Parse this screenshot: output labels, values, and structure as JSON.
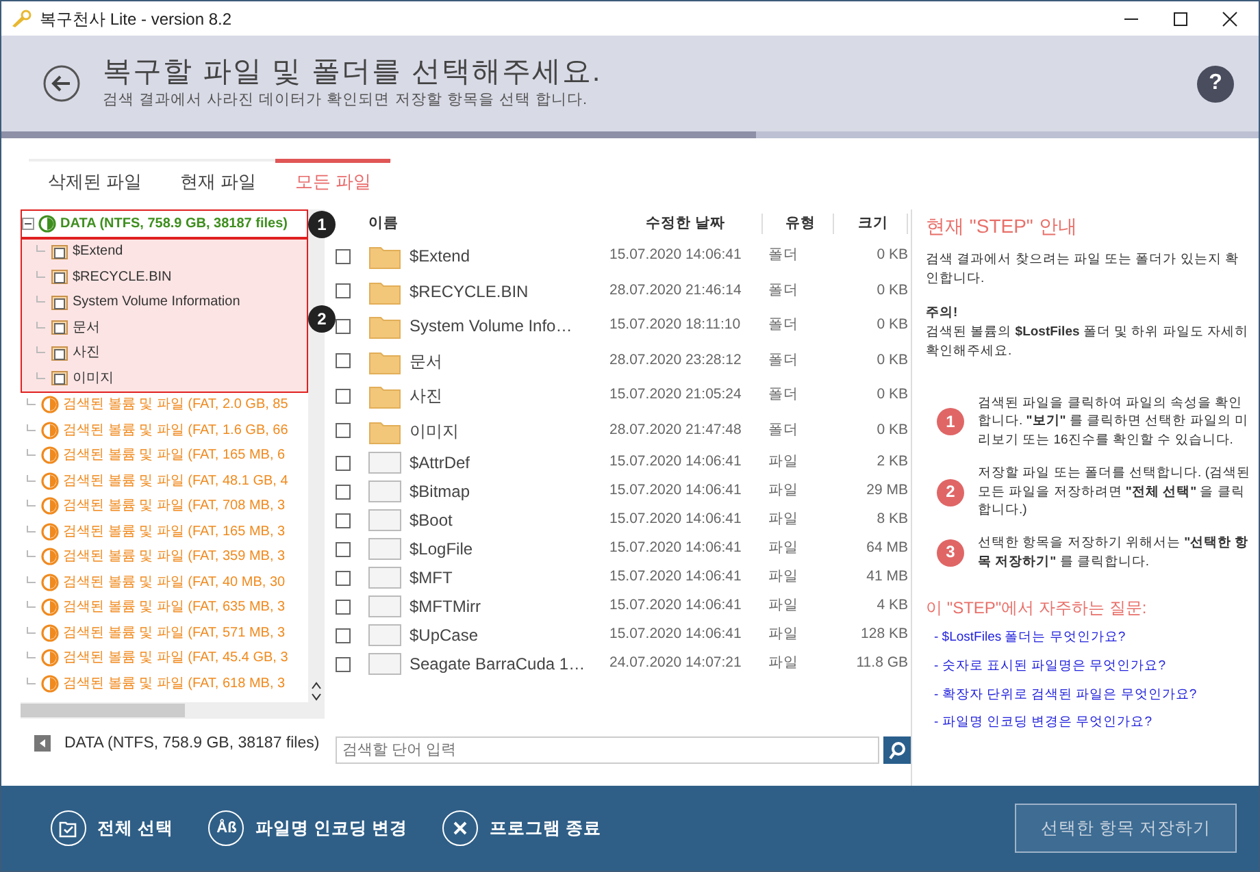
{
  "window": {
    "title": "복구천사 Lite - version 8.2"
  },
  "header": {
    "title": "복구할 파일 및 폴더를 선택해주세요.",
    "subtitle": "검색 결과에서 사라진 데이터가 확인되면 저장할 항목을 선택 합니다.",
    "help_glyph": "?"
  },
  "progress": {
    "level": 0.6
  },
  "tabs": [
    {
      "label": "삭제된 파일",
      "selected": false
    },
    {
      "label": "현재 파일",
      "selected": false
    },
    {
      "label": "모든 파일",
      "selected": true
    }
  ],
  "tree": {
    "root": {
      "label": "DATA (NTFS, 758.9 GB, 38187 files)",
      "color": "#3f8f1f",
      "expanded": true,
      "callout": "1",
      "children_callout": "2",
      "children": [
        {
          "label": "$Extend"
        },
        {
          "label": "$RECYCLE.BIN"
        },
        {
          "label": "System Volume Information"
        },
        {
          "label": "문서"
        },
        {
          "label": "사진"
        },
        {
          "label": "이미지"
        }
      ]
    },
    "volumes": [
      {
        "label": "검색된 볼륨 및 파일 (FAT, 2.0 GB, 85",
        "color": "#f08a1e"
      },
      {
        "label": "검색된 볼륨 및 파일 (FAT, 1.6 GB, 66",
        "color": "#f08a1e"
      },
      {
        "label": "검색된 볼륨 및 파일 (FAT, 165 MB, 6",
        "color": "#f08a1e"
      },
      {
        "label": "검색된 볼륨 및 파일 (FAT, 48.1 GB, 4",
        "color": "#f08a1e"
      },
      {
        "label": "검색된 볼륨 및 파일 (FAT, 708 MB, 3",
        "color": "#f08a1e"
      },
      {
        "label": "검색된 볼륨 및 파일 (FAT, 165 MB, 3",
        "color": "#f08a1e"
      },
      {
        "label": "검색된 볼륨 및 파일 (FAT, 359 MB, 3",
        "color": "#f08a1e"
      },
      {
        "label": "검색된 볼륨 및 파일 (FAT, 40 MB, 30",
        "color": "#f08a1e"
      },
      {
        "label": "검색된 볼륨 및 파일 (FAT, 635 MB, 3",
        "color": "#f08a1e"
      },
      {
        "label": "검색된 볼륨 및 파일 (FAT, 571 MB, 3",
        "color": "#f08a1e"
      },
      {
        "label": "검색된 볼륨 및 파일 (FAT, 45.4 GB, 3",
        "color": "#f08a1e"
      },
      {
        "label": "검색된 볼륨 및 파일 (FAT, 618 MB, 3",
        "color": "#f08a1e"
      }
    ]
  },
  "status_path": "DATA (NTFS, 758.9 GB, 38187 files)",
  "table": {
    "columns": [
      "이름",
      "수정한 날짜",
      "유형",
      "크기"
    ],
    "rows": [
      {
        "kind": "folder",
        "checked": false,
        "name": "$Extend",
        "modified": "15.07.2020 14:06:41",
        "type": "폴더",
        "size": "0 KB"
      },
      {
        "kind": "folder",
        "checked": false,
        "name": "$RECYCLE.BIN",
        "modified": "28.07.2020 21:46:14",
        "type": "폴더",
        "size": "0 KB"
      },
      {
        "kind": "folder",
        "checked": false,
        "name": "System Volume Info…",
        "modified": "15.07.2020 18:11:10",
        "type": "폴더",
        "size": "0 KB"
      },
      {
        "kind": "folder",
        "checked": false,
        "name": "문서",
        "modified": "28.07.2020 23:28:12",
        "type": "폴더",
        "size": "0 KB"
      },
      {
        "kind": "folder",
        "checked": false,
        "name": "사진",
        "modified": "15.07.2020 21:05:24",
        "type": "폴더",
        "size": "0 KB"
      },
      {
        "kind": "folder",
        "checked": false,
        "name": "이미지",
        "modified": "28.07.2020 21:47:48",
        "type": "폴더",
        "size": "0 KB"
      },
      {
        "kind": "file",
        "checked": false,
        "name": "$AttrDef",
        "modified": "15.07.2020 14:06:41",
        "type": "파일",
        "size": "2 KB"
      },
      {
        "kind": "file",
        "checked": false,
        "name": "$Bitmap",
        "modified": "15.07.2020 14:06:41",
        "type": "파일",
        "size": "29 MB"
      },
      {
        "kind": "file",
        "checked": false,
        "name": "$Boot",
        "modified": "15.07.2020 14:06:41",
        "type": "파일",
        "size": "8 KB"
      },
      {
        "kind": "file",
        "checked": false,
        "name": "$LogFile",
        "modified": "15.07.2020 14:06:41",
        "type": "파일",
        "size": "64 MB"
      },
      {
        "kind": "file",
        "checked": false,
        "name": "$MFT",
        "modified": "15.07.2020 14:06:41",
        "type": "파일",
        "size": "41 MB"
      },
      {
        "kind": "file",
        "checked": false,
        "name": "$MFTMirr",
        "modified": "15.07.2020 14:06:41",
        "type": "파일",
        "size": "4 KB"
      },
      {
        "kind": "file",
        "checked": false,
        "name": "$UpCase",
        "modified": "15.07.2020 14:06:41",
        "type": "파일",
        "size": "128 KB"
      },
      {
        "kind": "file",
        "checked": false,
        "name": "Seagate BarraCuda 1…",
        "modified": "24.07.2020 14:07:21",
        "type": "파일",
        "size": "11.8 GB"
      }
    ]
  },
  "search": {
    "placeholder": "검색할 단어 입력"
  },
  "guide": {
    "title": "현재 \"STEP\" 안내",
    "intro": "검색 결과에서 찾으려는 파일 또는 폴더가 있는지 확인합니다.",
    "note_title": "주의!",
    "note": "검색된 볼륨의 **$LostFiles** 폴더 및 하위 파일도 자세히 확인해주세요.",
    "steps": [
      {
        "number": "1",
        "text": "검색된 파일을 클릭하여 파일의 속성을 확인합니다. **\"보기\"** 를 클릭하면 선택한 파일의 미리보기 또는 16진수를 확인할 수 있습니다."
      },
      {
        "number": "2",
        "text": "저장할 파일 또는 폴더를 선택합니다. (검색된 모든 파일을 저장하려면 **\"전체 선택\"** 을 클릭합니다.)"
      },
      {
        "number": "3",
        "text": "선택한 항목을 저장하기 위해서는 **\"선택한 항목 저장하기\"** 를 클릭합니다."
      }
    ],
    "faq_title": "이 \"STEP\"에서 자주하는 질문:",
    "faq": [
      "- $LostFiles 폴더는 무엇인가요?",
      "- 숫자로 표시된 파일명은 무엇인가요?",
      "- 확장자 단위로 검색된 파일은 무엇인가요?",
      "- 파일명 인코딩 변경은 무엇인가요?"
    ]
  },
  "footer": {
    "actions": [
      {
        "kind": "select_all",
        "label": "전체 선택"
      },
      {
        "kind": "encoding",
        "label": "파일명 인코딩 변경",
        "icon_text": "Åß"
      },
      {
        "kind": "exit",
        "label": "프로그램 종료"
      }
    ],
    "save_button": {
      "label": "선택한 항목 저장하기",
      "disabled": true
    }
  }
}
